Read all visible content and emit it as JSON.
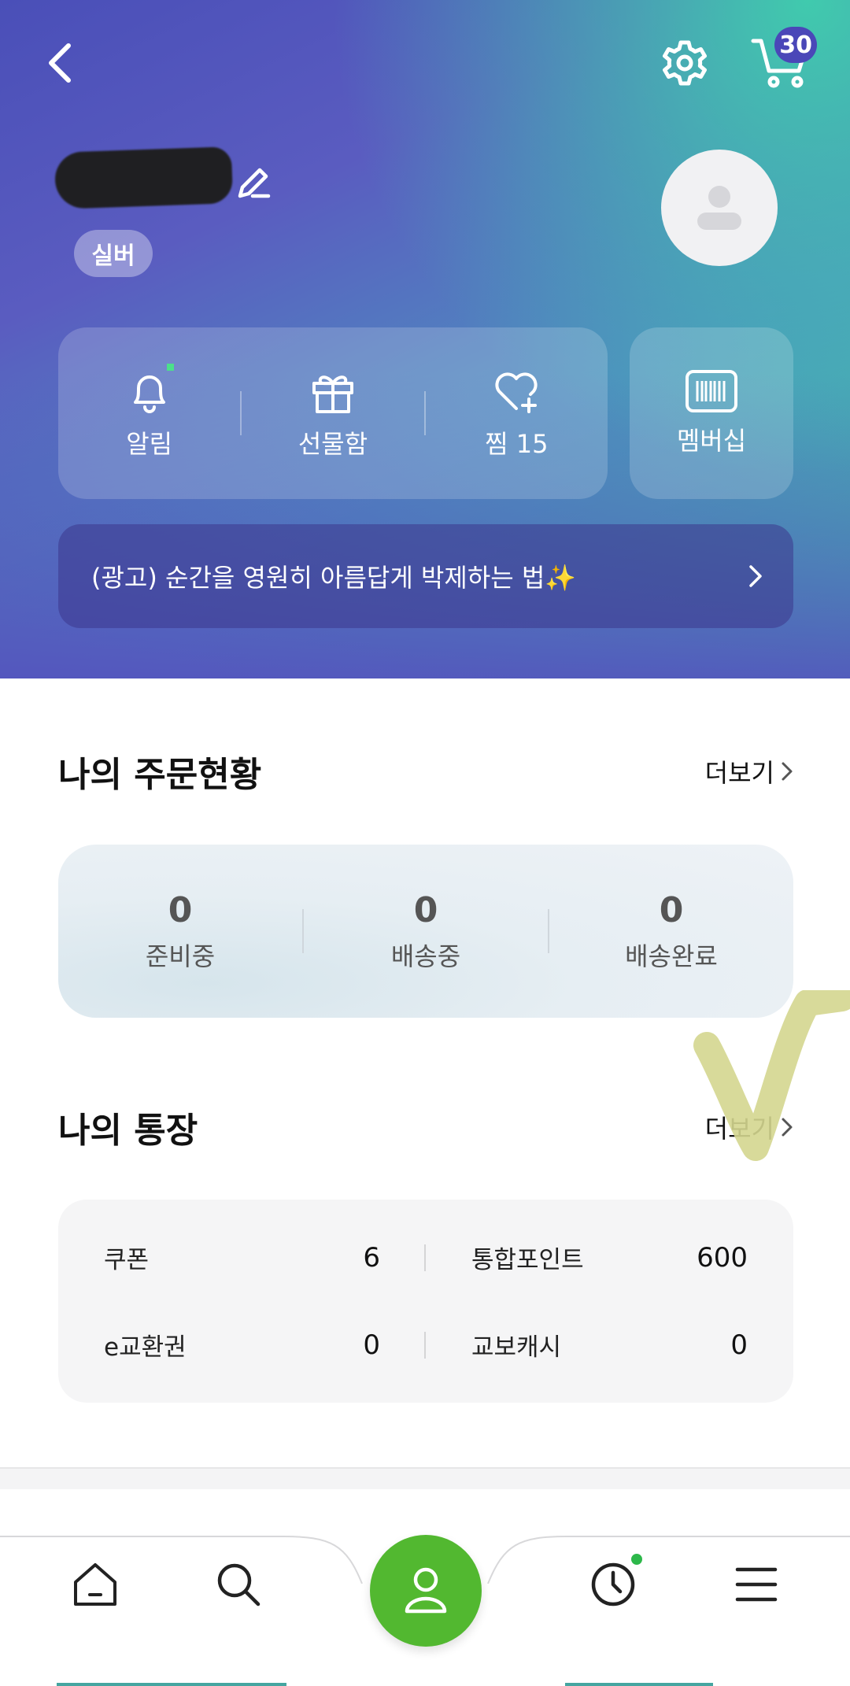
{
  "header": {
    "cart_count": "30",
    "grade": "실버"
  },
  "quick_menu": {
    "items": [
      {
        "label": "알림"
      },
      {
        "label": "선물함"
      },
      {
        "label": "찜 15"
      }
    ],
    "membership_label": "멤버십"
  },
  "ad_banner": {
    "text": "(광고) 순간을 영원히 아름답게 박제하는 법✨"
  },
  "orders": {
    "title": "나의 주문현황",
    "more_label": "더보기",
    "statuses": [
      {
        "count": "0",
        "label": "준비중"
      },
      {
        "count": "0",
        "label": "배송중"
      },
      {
        "count": "0",
        "label": "배송완료"
      }
    ]
  },
  "wallet": {
    "title": "나의 통장",
    "more_label": "더보기",
    "items": [
      {
        "label": "쿠폰",
        "value": "6"
      },
      {
        "label": "통합포인트",
        "value": "600"
      },
      {
        "label": "e교환권",
        "value": "0"
      },
      {
        "label": "교보캐시",
        "value": "0"
      }
    ]
  },
  "bottom_nav": {
    "items": [
      "home-icon",
      "search-icon",
      "my-page-icon",
      "recent-icon",
      "menu-icon"
    ]
  },
  "colors": {
    "gradient_start": "#4a4fb8",
    "gradient_end": "#3fcfa8",
    "cart_badge": "#4a47b8",
    "nav_active": "#52b830",
    "recent_dot": "#2db84a",
    "check_mark": "#d4d68f"
  }
}
